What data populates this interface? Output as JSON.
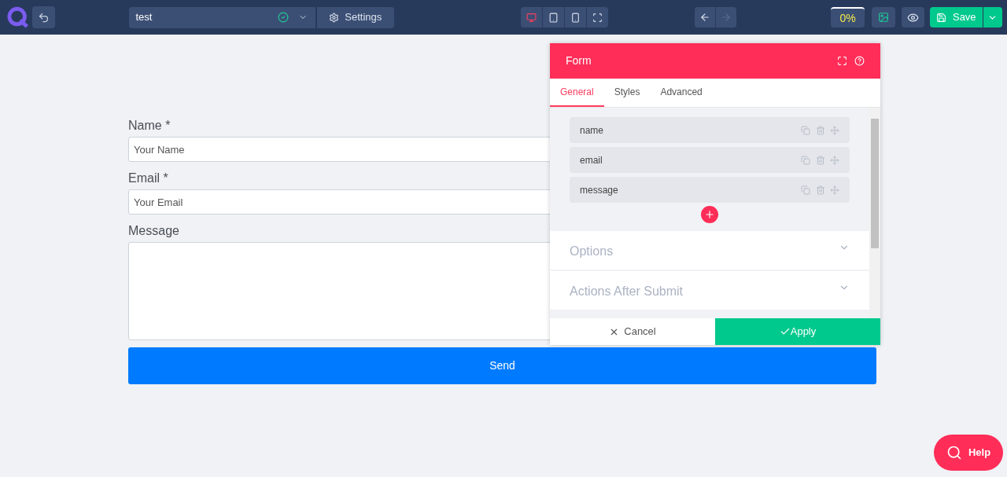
{
  "toolbar": {
    "page_name": "test",
    "settings_label": "Settings",
    "devices": [
      {
        "kind": "desktop",
        "selected": true
      },
      {
        "kind": "tablet",
        "selected": false
      },
      {
        "kind": "mobile",
        "selected": false
      },
      {
        "kind": "fullscreen",
        "selected": false
      }
    ],
    "redo_disabled": true,
    "progress": "0%",
    "save_label": "Save"
  },
  "form": {
    "fields": [
      {
        "kind": "input",
        "label": "Name *",
        "placeholder": "Your Name"
      },
      {
        "kind": "input",
        "label": "Email *",
        "placeholder": "Your Email"
      },
      {
        "kind": "textarea",
        "label": "Message"
      }
    ],
    "submit": "Send"
  },
  "panel": {
    "title": "Form",
    "tabs": [
      {
        "label": "General",
        "selected": true
      },
      {
        "label": "Styles",
        "selected": false
      },
      {
        "label": "Advanced",
        "selected": false
      }
    ],
    "items": [
      "name",
      "email",
      "message"
    ],
    "sections": [
      {
        "label": "Options",
        "expanded": false
      },
      {
        "label": "Actions After Submit",
        "expanded": false
      }
    ],
    "cancel": "Cancel",
    "apply": "Apply"
  },
  "help": "Help"
}
